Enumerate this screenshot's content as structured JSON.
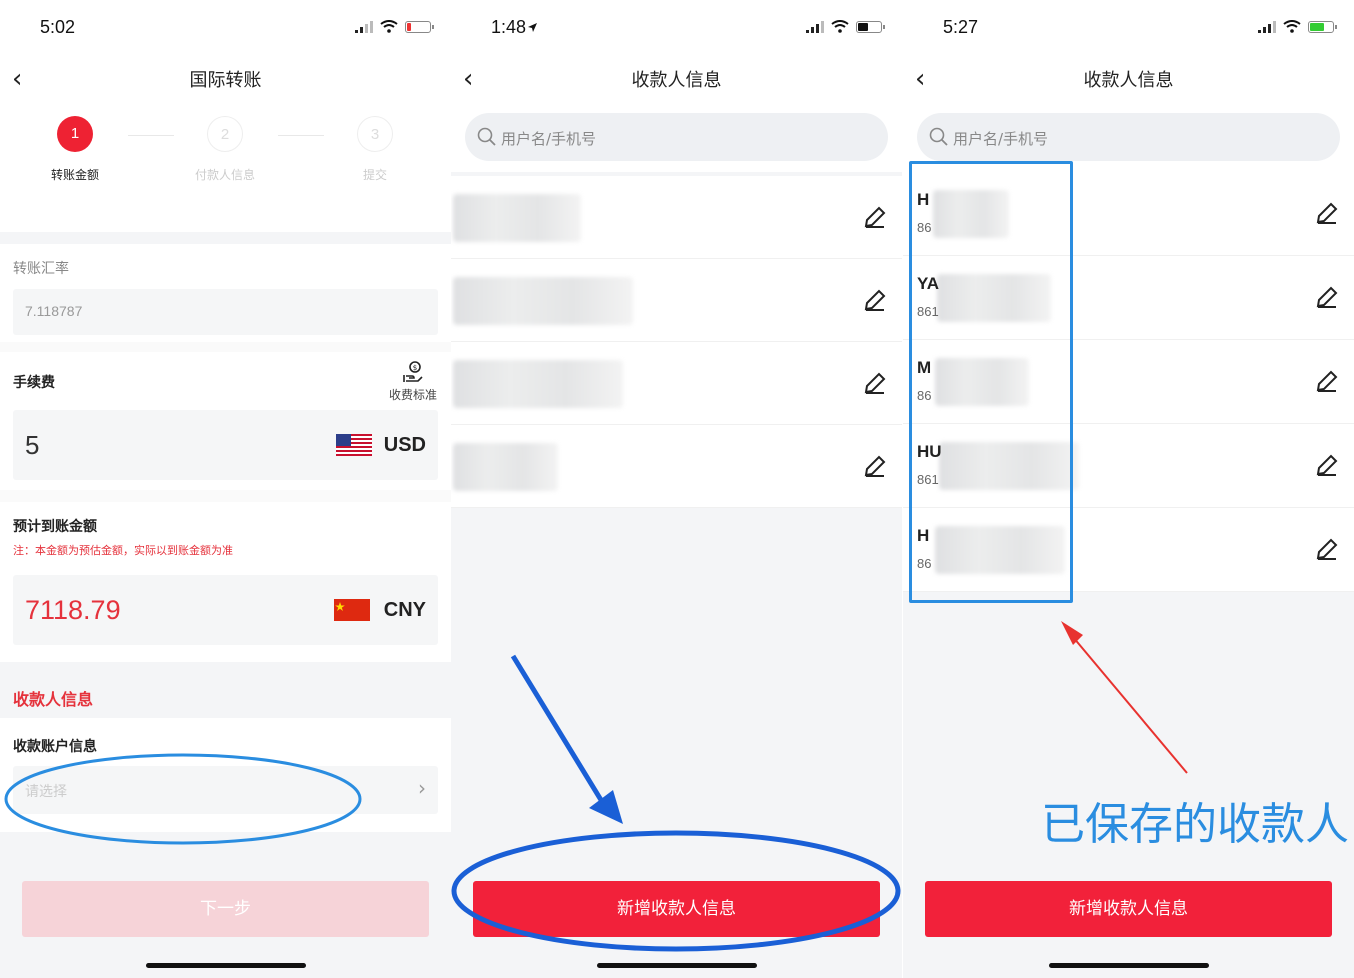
{
  "panel1": {
    "time": "5:02",
    "nav_title": "国际转账",
    "steps": [
      {
        "num": "1",
        "label": "转账金额",
        "active": true
      },
      {
        "num": "2",
        "label": "付款人信息",
        "active": false
      },
      {
        "num": "3",
        "label": "提交",
        "active": false
      }
    ],
    "rate_label": "转账汇率",
    "rate_value": "7.118787",
    "fee_label": "手续费",
    "fee_standard": "收费标准",
    "fee_value": "5",
    "fee_currency": "USD",
    "expected_label": "预计到账金额",
    "expected_note": "注：本金额为预估金额，实际以到账金额为准",
    "expected_value": "7118.79",
    "expected_currency": "CNY",
    "payee_section": "收款人信息",
    "account_label": "收款账户信息",
    "account_placeholder": "请选择",
    "next_button": "下一步"
  },
  "panel2": {
    "time": "1:48",
    "nav_title": "收款人信息",
    "search_placeholder": "用户名/手机号",
    "add_button": "新增收款人信息"
  },
  "panel3": {
    "time": "5:27",
    "nav_title": "收款人信息",
    "search_placeholder": "用户名/手机号",
    "payees": [
      {
        "initial": "H",
        "phone": "86"
      },
      {
        "initial": "YA",
        "phone": "861"
      },
      {
        "initial": "M",
        "phone": "86"
      },
      {
        "initial": "HU",
        "phone": "861"
      },
      {
        "initial": "H",
        "phone": "86"
      }
    ],
    "annotation": "已保存的收款人",
    "add_button": "新增收款人信息"
  },
  "colors": {
    "primary_red": "#f2213a",
    "disabled_red": "#f6d3d8",
    "highlight_blue": "#2a8de0",
    "arrow_blue": "#1a5fd6",
    "arrow_red": "#e8322f"
  }
}
